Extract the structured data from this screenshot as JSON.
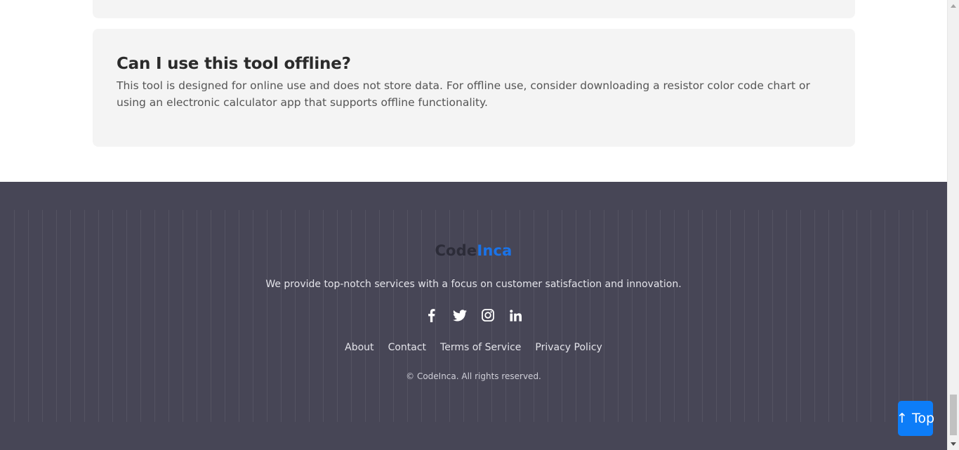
{
  "faq": {
    "question": "Can I use this tool offline?",
    "answer": "This tool is designed for online use and does not store data. For offline use, consider downloading a resistor color code chart or using an electronic calculator app that supports offline functionality."
  },
  "footer": {
    "brand_part1": "Code",
    "brand_part2": "Inca",
    "tagline": "We provide top-notch services with a focus on customer satisfaction and innovation.",
    "social_icons": [
      "facebook-icon",
      "twitter-icon",
      "instagram-icon",
      "linkedin-icon"
    ],
    "links": {
      "about": "About",
      "contact": "Contact",
      "terms": "Terms of Service",
      "privacy": "Privacy Policy"
    },
    "copyright": "© CodeInca. All rights reserved."
  },
  "back_to_top": {
    "label": "↑ Top"
  },
  "colors": {
    "footer_bg": "#474656",
    "brand_accent": "#1a73e8",
    "button_bg": "#0d7df8",
    "card_bg": "#f4f4f4"
  }
}
